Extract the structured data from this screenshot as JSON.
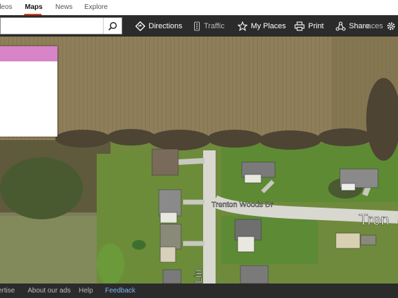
{
  "top_nav": {
    "items": [
      {
        "label": "Videos",
        "shown": "deos"
      },
      {
        "label": "Maps",
        "active": true
      },
      {
        "label": "News"
      },
      {
        "label": "Explore"
      }
    ]
  },
  "toolbar": {
    "search": {
      "value": "",
      "placeholder": ""
    },
    "directions_label": "Directions",
    "traffic_label": "Traffic",
    "myplaces_label": "My Places",
    "print_label": "Print",
    "share_label": "Share",
    "overlap_label": "aces"
  },
  "map": {
    "view": "aerial",
    "streets": {
      "main": "Trenton Woods Dr",
      "main_partial": "Tren",
      "side_partial": "Lin"
    },
    "colors": {
      "toolbar_bg": "#2b2b2b",
      "panel_header": "#d884c8",
      "accent": "#e04020"
    }
  },
  "footer": {
    "items": [
      {
        "label": "Advertise",
        "shown": "ertise"
      },
      {
        "label": "About our ads"
      },
      {
        "label": "Help"
      },
      {
        "label": "Feedback",
        "link": true
      }
    ]
  }
}
